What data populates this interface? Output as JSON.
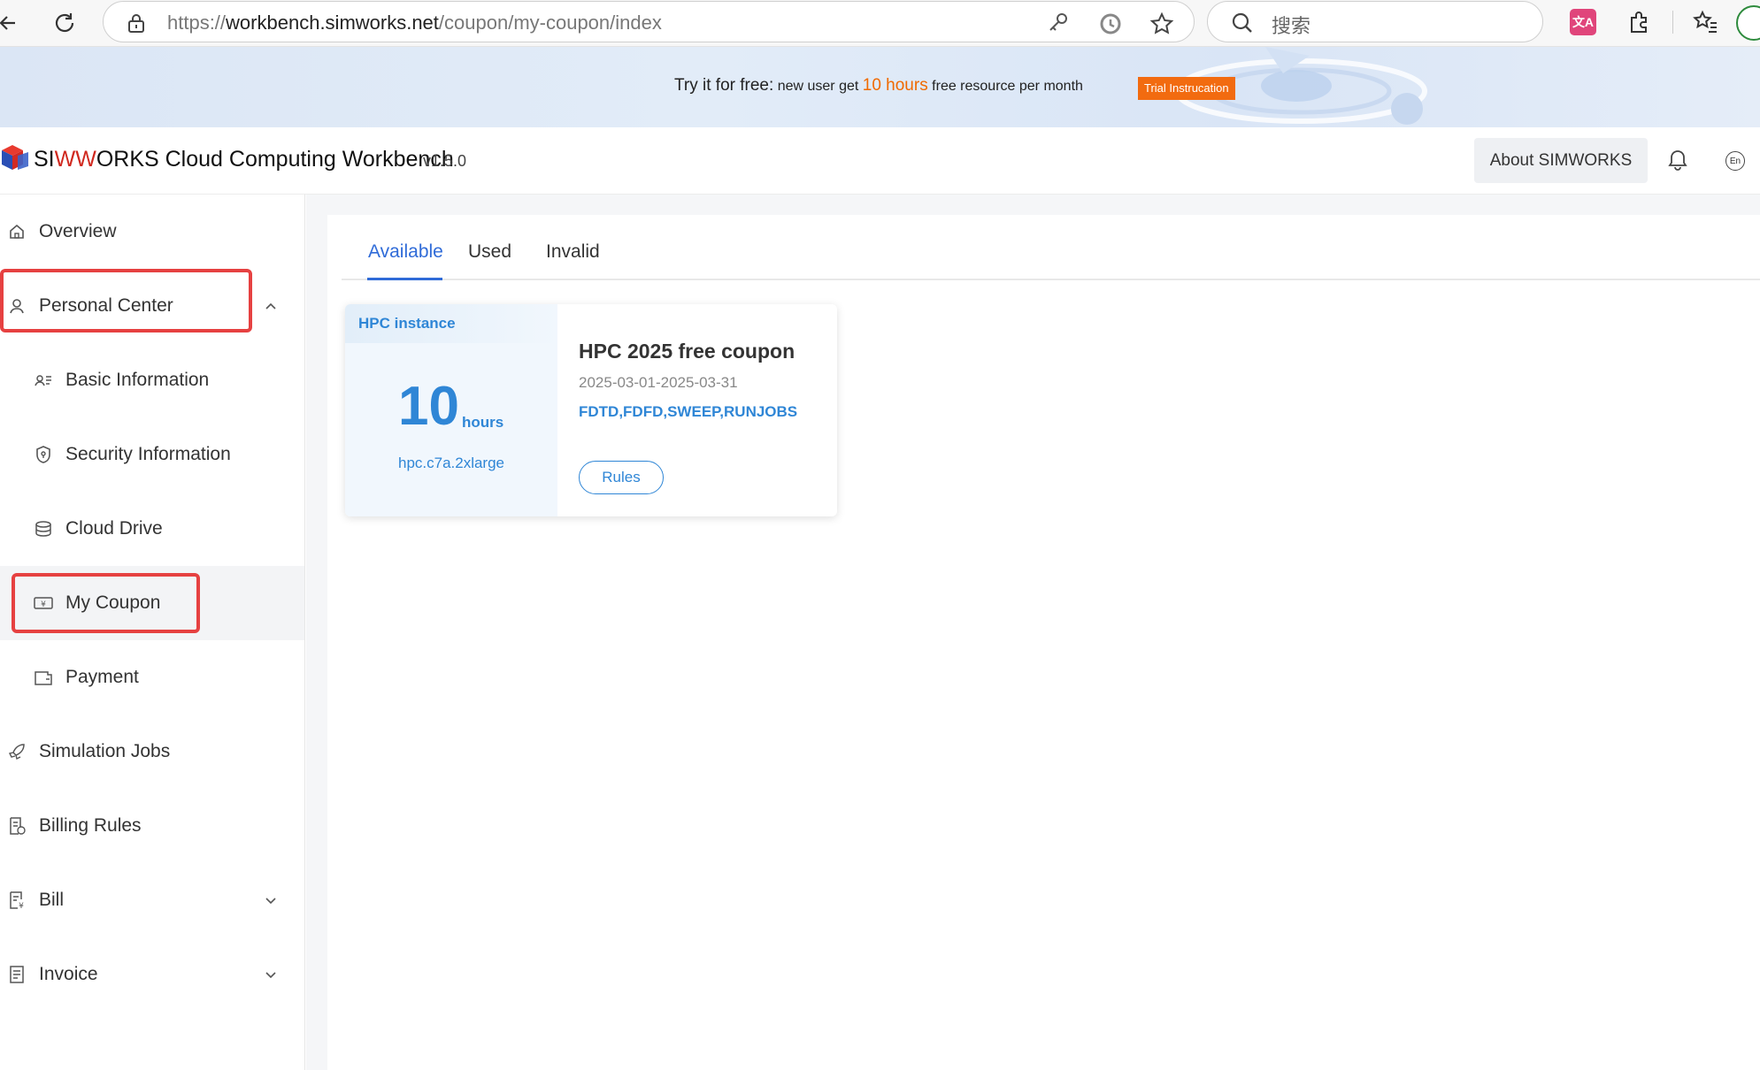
{
  "browser": {
    "url_prefix": "https://",
    "url_host": "workbench.simworks.net",
    "url_path": "/coupon/my-coupon/index",
    "search_placeholder": "搜索"
  },
  "banner": {
    "lead": "Try it for free:",
    "text1": " new user get ",
    "highlight": "10 hours",
    "text2": " free resource per month",
    "trial_button": "Trial Instrucation",
    "highlight_color": "#f06a00"
  },
  "header": {
    "brand_prefix": "SI",
    "brand_ww": "WW",
    "brand_suffix": "ORKS Cloud Computing Workbench",
    "version": "v1.5.0",
    "about_button": "About SIMWORKS",
    "lang": "En"
  },
  "sidebar": {
    "overview": "Overview",
    "personal_center": "Personal Center",
    "basic_information": "Basic Information",
    "security_information": "Security Information",
    "cloud_drive": "Cloud Drive",
    "my_coupon": "My Coupon",
    "payment": "Payment",
    "simulation_jobs": "Simulation Jobs",
    "billing_rules": "Billing Rules",
    "bill": "Bill",
    "invoice": "Invoice"
  },
  "tabs": {
    "available": "Available",
    "used": "Used",
    "invalid": "Invalid",
    "active_color": "#2f6bd8"
  },
  "coupon": {
    "tag": "HPC instance",
    "amount": "10",
    "unit": "hours",
    "instance": "hpc.c7a.2xlarge",
    "title": "HPC 2025 free coupon",
    "date_range": "2025-03-01-2025-03-31",
    "scope": "FDTD,FDFD,SWEEP,RUNJOBS",
    "rules_button": "Rules",
    "accent_color": "#2f86d6"
  },
  "annotation_color": "#e64141"
}
